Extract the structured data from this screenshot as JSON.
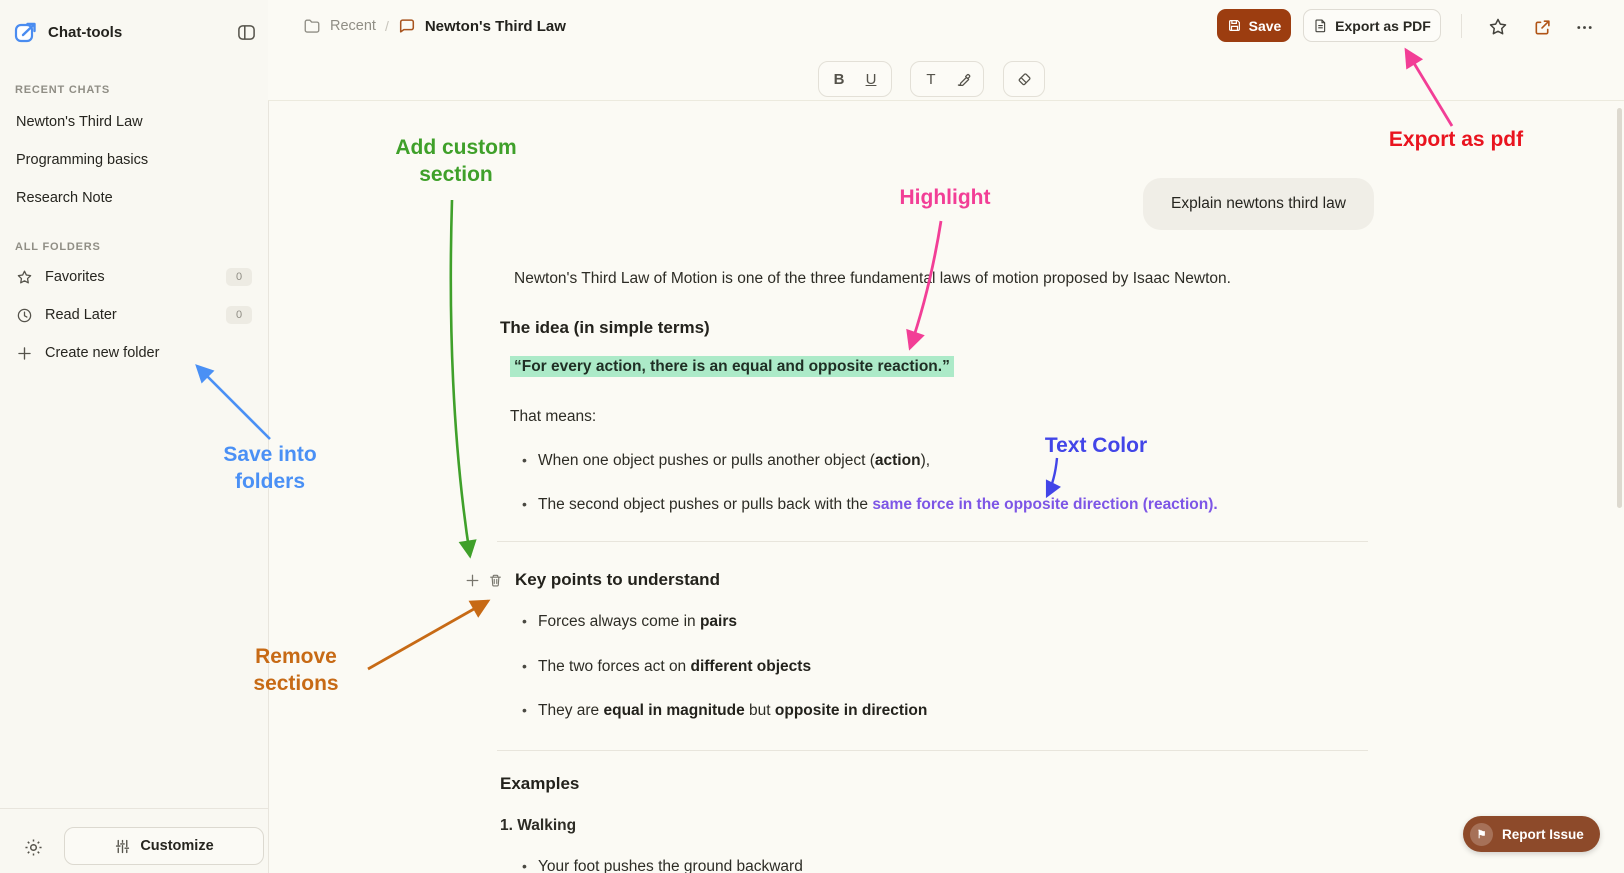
{
  "app": {
    "title": "Chat-tools"
  },
  "sidebar": {
    "recent_chats_heading": "RECENT CHATS",
    "recent_chats": [
      {
        "label": "Newton's Third Law"
      },
      {
        "label": "Programming basics"
      },
      {
        "label": "Research Note"
      }
    ],
    "all_folders_heading": "ALL FOLDERS",
    "folders": [
      {
        "label": "Favorites",
        "count": "0",
        "icon": "star-icon"
      },
      {
        "label": "Read Later",
        "count": "0",
        "icon": "clock-icon"
      }
    ],
    "create_folder_label": "Create new folder",
    "customize_label": "Customize"
  },
  "header": {
    "breadcrumb_parent": "Recent",
    "breadcrumb_separator": "/",
    "breadcrumb_current": "Newton's Third Law",
    "save_label": "Save",
    "export_label": "Export as PDF"
  },
  "toolbar": {
    "bold": "B",
    "underline": "U",
    "text_color": "T"
  },
  "chat": {
    "user_message": "Explain newtons third law"
  },
  "doc": {
    "intro": "Newton's Third Law of Motion is one of the three fundamental laws of motion proposed by Isaac Newton.",
    "idea_heading": "The idea (in simple terms)",
    "quote": "“For every action, there is an equal and opposite reaction.”",
    "that_means": "That means:",
    "bullet1": [
      "When one object pushes or pulls another object (",
      "action",
      "),"
    ],
    "bullet2": [
      "The second object pushes or pulls back with the ",
      "same force in the opposite direction (reaction)."
    ],
    "key_heading": "Key points to understand",
    "key_bullet1": [
      "Forces always come in ",
      "pairs"
    ],
    "key_bullet2": [
      "The two forces act on ",
      "different objects"
    ],
    "key_bullet3": [
      "They are ",
      "equal in magnitude",
      " but ",
      "opposite in direction"
    ],
    "examples_heading": "Examples",
    "walking_heading": "1. Walking",
    "walking_bullet1": "Your foot pushes the ground backward"
  },
  "annotations": {
    "add_custom": {
      "line1": "Add custom",
      "line2": "section"
    },
    "highlight": {
      "label": "Highlight"
    },
    "export_pdf": {
      "label": "Export as pdf"
    },
    "save_folders": {
      "line1": "Save into",
      "line2": "folders"
    },
    "remove_sections": {
      "line1": "Remove",
      "line2": "sections"
    },
    "text_color": {
      "label": "Text Color"
    }
  },
  "report_issue": {
    "label": "Report Issue"
  },
  "colors": {
    "ann_green": "#3fa02a",
    "ann_pink": "#f23e96",
    "ann_red": "#e9141f",
    "ann_blue": "#4a90f5",
    "ann_indigo": "#4245e8",
    "ann_orange": "#c76a15",
    "highlight_bg": "#aceac8",
    "purple_text": "#7d55e6",
    "save_button_bg": "#9c3d10",
    "report_button_bg": "#8d4a2a",
    "accent_blue": "#4a8cf0"
  }
}
